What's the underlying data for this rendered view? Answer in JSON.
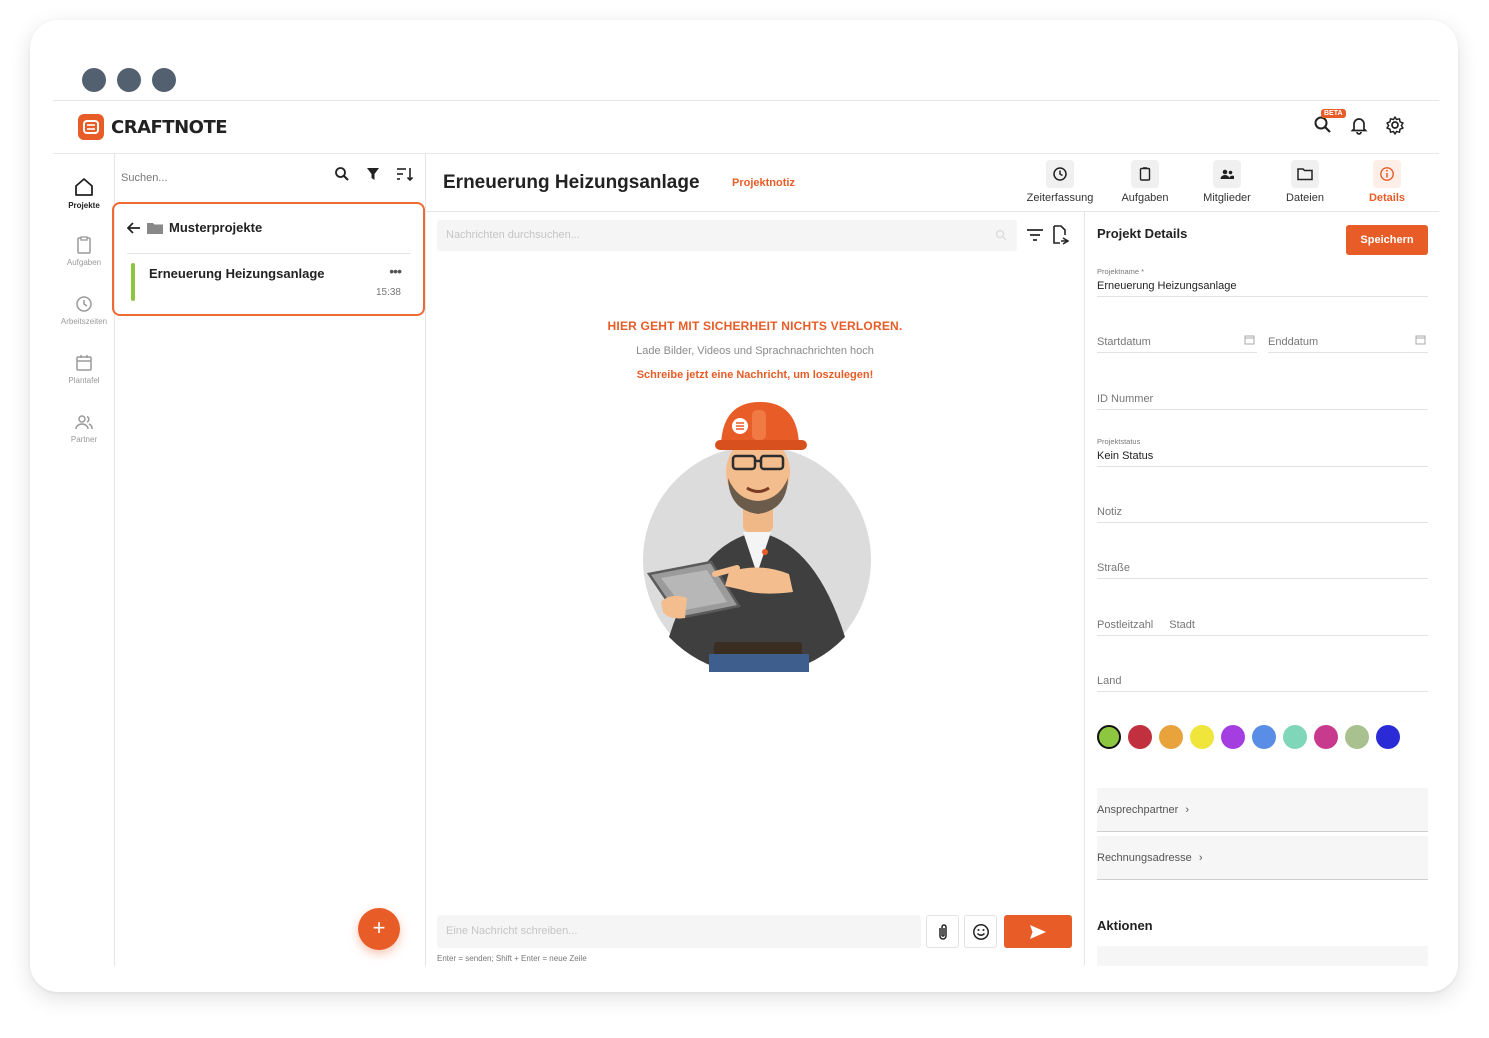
{
  "app": {
    "brand": "CRAFTNOTE",
    "beta_badge": "BETA"
  },
  "nav": {
    "items": [
      {
        "label": "Projekte",
        "icon": "home-icon"
      },
      {
        "label": "Aufgaben",
        "icon": "clipboard-icon"
      },
      {
        "label": "Arbeitszeiten",
        "icon": "clock-icon"
      },
      {
        "label": "Plantafel",
        "icon": "calendar-icon"
      },
      {
        "label": "Partner",
        "icon": "users-icon"
      }
    ]
  },
  "list": {
    "search_placeholder": "Suchen...",
    "folder": "Musterprojekte",
    "project": {
      "name": "Erneuerung Heizungsanlage",
      "time": "15:38",
      "color": "#8dc63f"
    },
    "fab_label": "+"
  },
  "header": {
    "title": "Erneuerung Heizungsanlage",
    "tag": "Projektnotiz",
    "tabs": [
      {
        "label": "Zeiterfassung",
        "icon": "clock-icon"
      },
      {
        "label": "Aufgaben",
        "icon": "clipboard-icon"
      },
      {
        "label": "Mitglieder",
        "icon": "members-icon"
      },
      {
        "label": "Dateien",
        "icon": "folder-icon"
      },
      {
        "label": "Details",
        "icon": "info-icon",
        "active": true
      }
    ]
  },
  "chat": {
    "search_placeholder": "Nachrichten durchsuchen...",
    "empty_title": "HIER GEHT MIT SICHERHEIT NICHTS VERLOREN.",
    "empty_sub": "Lade Bilder, Videos und Sprachnachrichten hoch",
    "empty_cta": "Schreibe jetzt eine Nachricht, um loszulegen!",
    "composer_placeholder": "Eine Nachricht schreiben...",
    "hint": "Enter = senden; Shift + Enter = neue Zeile"
  },
  "details": {
    "title": "Projekt Details",
    "save": "Speichern",
    "projektname_label": "Projektname *",
    "projektname_value": "Erneuerung Heizungsanlage",
    "startdatum": "Startdatum",
    "enddatum": "Enddatum",
    "id_nummer": "ID Nummer",
    "projektstatus_label": "Projektstatus",
    "projektstatus_value": "Kein Status",
    "notiz": "Notiz",
    "strasse": "Straße",
    "postleitzahl": "Postleitzahl",
    "stadt": "Stadt",
    "land": "Land",
    "colors": [
      "#8dc63f",
      "#c0303f",
      "#e8a33c",
      "#f0e53a",
      "#a43ee0",
      "#5a8ee6",
      "#7fd6b8",
      "#c83a8e",
      "#a9c08f",
      "#2a2bd6"
    ],
    "selected_color": "#8dc63f",
    "ansprechpartner": "Ansprechpartner",
    "rechnungsadresse": "Rechnungsadresse",
    "aktionen": "Aktionen"
  }
}
